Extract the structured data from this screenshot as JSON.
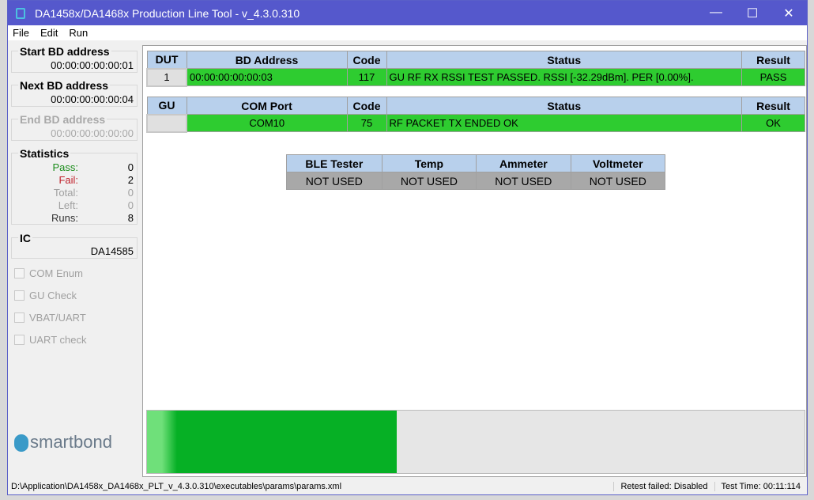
{
  "window": {
    "title": "DA1458x/DA1468x Production Line Tool - v_4.3.0.310",
    "minimize": "—",
    "maximize": "☐",
    "close": "✕"
  },
  "menu": [
    "File",
    "Edit",
    "Run"
  ],
  "sidebar": {
    "start_bd": {
      "label": "Start BD address",
      "value": "00:00:00:00:00:01"
    },
    "next_bd": {
      "label": "Next BD address",
      "value": "00:00:00:00:00:04"
    },
    "end_bd": {
      "label": "End BD address",
      "value": "00:00:00:00:00:00"
    },
    "statistics": {
      "label": "Statistics",
      "rows": [
        {
          "k": "Pass:",
          "v": "0",
          "c": "#1a8c1a"
        },
        {
          "k": "Fail:",
          "v": "2",
          "c": "#c0202a"
        },
        {
          "k": "Total:",
          "v": "0",
          "c": "#a0a0a0"
        },
        {
          "k": "Left:",
          "v": "0",
          "c": "#a0a0a0"
        },
        {
          "k": "Runs:",
          "v": "8",
          "c": "#333"
        }
      ]
    },
    "ic": {
      "label": "IC",
      "value": "DA14585"
    },
    "checks": [
      "COM Enum",
      "GU Check",
      "VBAT/UART",
      "UART check"
    ],
    "logo": "smartbond"
  },
  "dut_table": {
    "headers": [
      "DUT",
      "BD Address",
      "Code",
      "Status",
      "Result"
    ],
    "row": [
      "1",
      "00:00:00:00:00:03",
      "117",
      "GU RF RX RSSI TEST PASSED. RSSI [-32.29dBm]. PER [0.00%].",
      "PASS"
    ]
  },
  "gu_table": {
    "headers": [
      "GU",
      "COM Port",
      "Code",
      "Status",
      "Result"
    ],
    "row": [
      "",
      "COM10",
      "75",
      "RF PACKET TX ENDED OK",
      "OK"
    ]
  },
  "equipment": {
    "headers": [
      "BLE Tester",
      "Temp",
      "Ammeter",
      "Voltmeter"
    ],
    "values": [
      "NOT USED",
      "NOT USED",
      "NOT USED",
      "NOT USED"
    ]
  },
  "progress": {
    "percent": 38,
    "color": "#06b025"
  },
  "statusbar": {
    "path": "D:\\Application\\DA1458x_DA1468x_PLT_v_4.3.0.310\\executables\\params\\params.xml",
    "retest": "Retest failed: Disabled",
    "time": "Test Time: 00:11:114"
  }
}
